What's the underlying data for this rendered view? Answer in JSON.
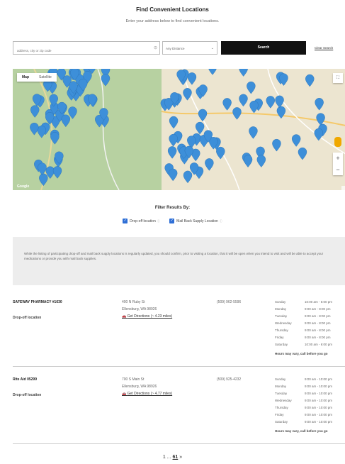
{
  "header": {
    "title": "Find Convenient Locations",
    "subtitle": "Enter your address below to find convenient locations."
  },
  "search": {
    "address_placeholder": "address, city or zip code",
    "distance_value": "Any Distance",
    "search_label": "Search",
    "clear_label": "Clear Search"
  },
  "map": {
    "tab_map": "Map",
    "tab_satellite": "Satellite",
    "zoom_in": "+",
    "zoom_out": "−",
    "google_logo": "Google"
  },
  "filters": {
    "title": "Filter Results By:",
    "options": [
      {
        "label": "Drop-off location",
        "checked": true
      },
      {
        "label": "Mail Back Supply Location",
        "checked": true
      }
    ]
  },
  "notice": "While the listing of participating drop-off and mail back supply locations is regularly updated, you should confirm, prior to visiting a location, that it will be open when you intend to visit and will be able to accept your medications or provide you with mail back supplies.",
  "locations": [
    {
      "name": "SAFEWAY PHARMACY #1630",
      "type": "Drop-off location",
      "address1": "400 N Ruby St",
      "address2": "Ellensburg, WA 98926",
      "directions": "Get Directions (~ 4.23 miles)",
      "phone": "(509) 962-5596",
      "hours": [
        {
          "day": "Sunday",
          "time": "10:00 am - 5:00 pm"
        },
        {
          "day": "Monday",
          "time": "9:00 am - 8:00 pm"
        },
        {
          "day": "Tuesday",
          "time": "9:00 am - 8:00 pm"
        },
        {
          "day": "Wednesday",
          "time": "9:00 am - 8:00 pm"
        },
        {
          "day": "Thursday",
          "time": "9:00 am - 8:00 pm"
        },
        {
          "day": "Friday",
          "time": "9:00 am - 8:00 pm"
        },
        {
          "day": "Saturday",
          "time": "10:00 am - 6:00 pm"
        }
      ],
      "hours_note": "Hours may vary, call before you go"
    },
    {
      "name": "Rite Aid 05299",
      "type": "Drop-off location",
      "address1": "700 S Main St",
      "address2": "Ellensburg, WA 98926",
      "directions": "Get Directions (~ 4.77 miles)",
      "phone": "(509) 925-4232",
      "hours": [
        {
          "day": "Sunday",
          "time": "9:00 am - 10:00 pm"
        },
        {
          "day": "Monday",
          "time": "9:00 am - 10:00 pm"
        },
        {
          "day": "Tuesday",
          "time": "9:00 am - 10:00 pm"
        },
        {
          "day": "Wednesday",
          "time": "9:00 am - 10:00 pm"
        },
        {
          "day": "Thursday",
          "time": "9:00 am - 10:00 pm"
        },
        {
          "day": "Friday",
          "time": "9:00 am - 10:00 pm"
        },
        {
          "day": "Saturday",
          "time": "9:00 am - 10:00 pm"
        }
      ],
      "hours_note": "Hours may vary, call before you go"
    }
  ],
  "pagination": {
    "first": "1",
    "ellipsis": "...",
    "current": "61",
    "next": "»"
  },
  "colors": {
    "pin": "#3d8fd9",
    "checkbox": "#2f6fd6",
    "search_button": "#111111"
  }
}
